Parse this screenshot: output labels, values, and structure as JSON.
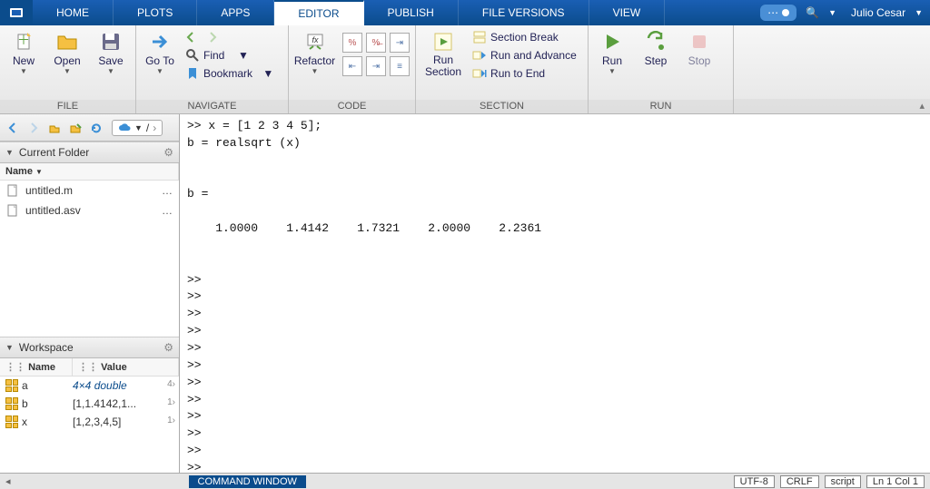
{
  "user_name": "Julio Cesar",
  "tabs": {
    "home": "HOME",
    "plots": "PLOTS",
    "apps": "APPS",
    "editor": "EDITOR",
    "publish": "PUBLISH",
    "file_versions": "FILE VERSIONS",
    "view": "VIEW"
  },
  "ribbon": {
    "file": {
      "label": "FILE",
      "new": "New",
      "open": "Open",
      "save": "Save"
    },
    "navigate": {
      "label": "NAVIGATE",
      "goto": "Go To",
      "find": "Find",
      "bookmark": "Bookmark"
    },
    "code": {
      "label": "CODE",
      "refactor": "Refactor"
    },
    "section": {
      "label": "SECTION",
      "run_section": "Run\nSection",
      "break": "Section Break",
      "advance": "Run and Advance",
      "to_end": "Run to End"
    },
    "run": {
      "label": "RUN",
      "run": "Run",
      "step": "Step",
      "stop": "Stop"
    }
  },
  "current_folder": {
    "title": "Current Folder",
    "col_name": "Name",
    "files": [
      {
        "name": "untitled.m"
      },
      {
        "name": "untitled.asv"
      }
    ]
  },
  "workspace": {
    "title": "Workspace",
    "col_name": "Name",
    "col_value": "Value",
    "vars": [
      {
        "name": "a",
        "value": "4×4 double",
        "style": "italic",
        "dim": "4›"
      },
      {
        "name": "b",
        "value": "[1,1.4142,1...",
        "style": "normal",
        "dim": "1›"
      },
      {
        "name": "x",
        "value": "[1,2,3,4,5]",
        "style": "normal",
        "dim": "1›"
      }
    ]
  },
  "command_window": {
    "label": "COMMAND WINDOW",
    "lines": [
      ">> x = [1 2 3 4 5];",
      "b = realsqrt (x)",
      "",
      "",
      "b =",
      "",
      "    1.0000    1.4142    1.7321    2.0000    2.2361",
      "",
      "",
      ">>",
      ">>",
      ">>",
      ">>",
      ">>",
      ">>",
      ">>",
      ">>",
      ">>",
      ">>",
      ">>",
      ">>",
      ">> "
    ]
  },
  "status": {
    "encoding": "UTF-8",
    "eol": "CRLF",
    "type": "script",
    "pos": "Ln  1  Col  1"
  }
}
